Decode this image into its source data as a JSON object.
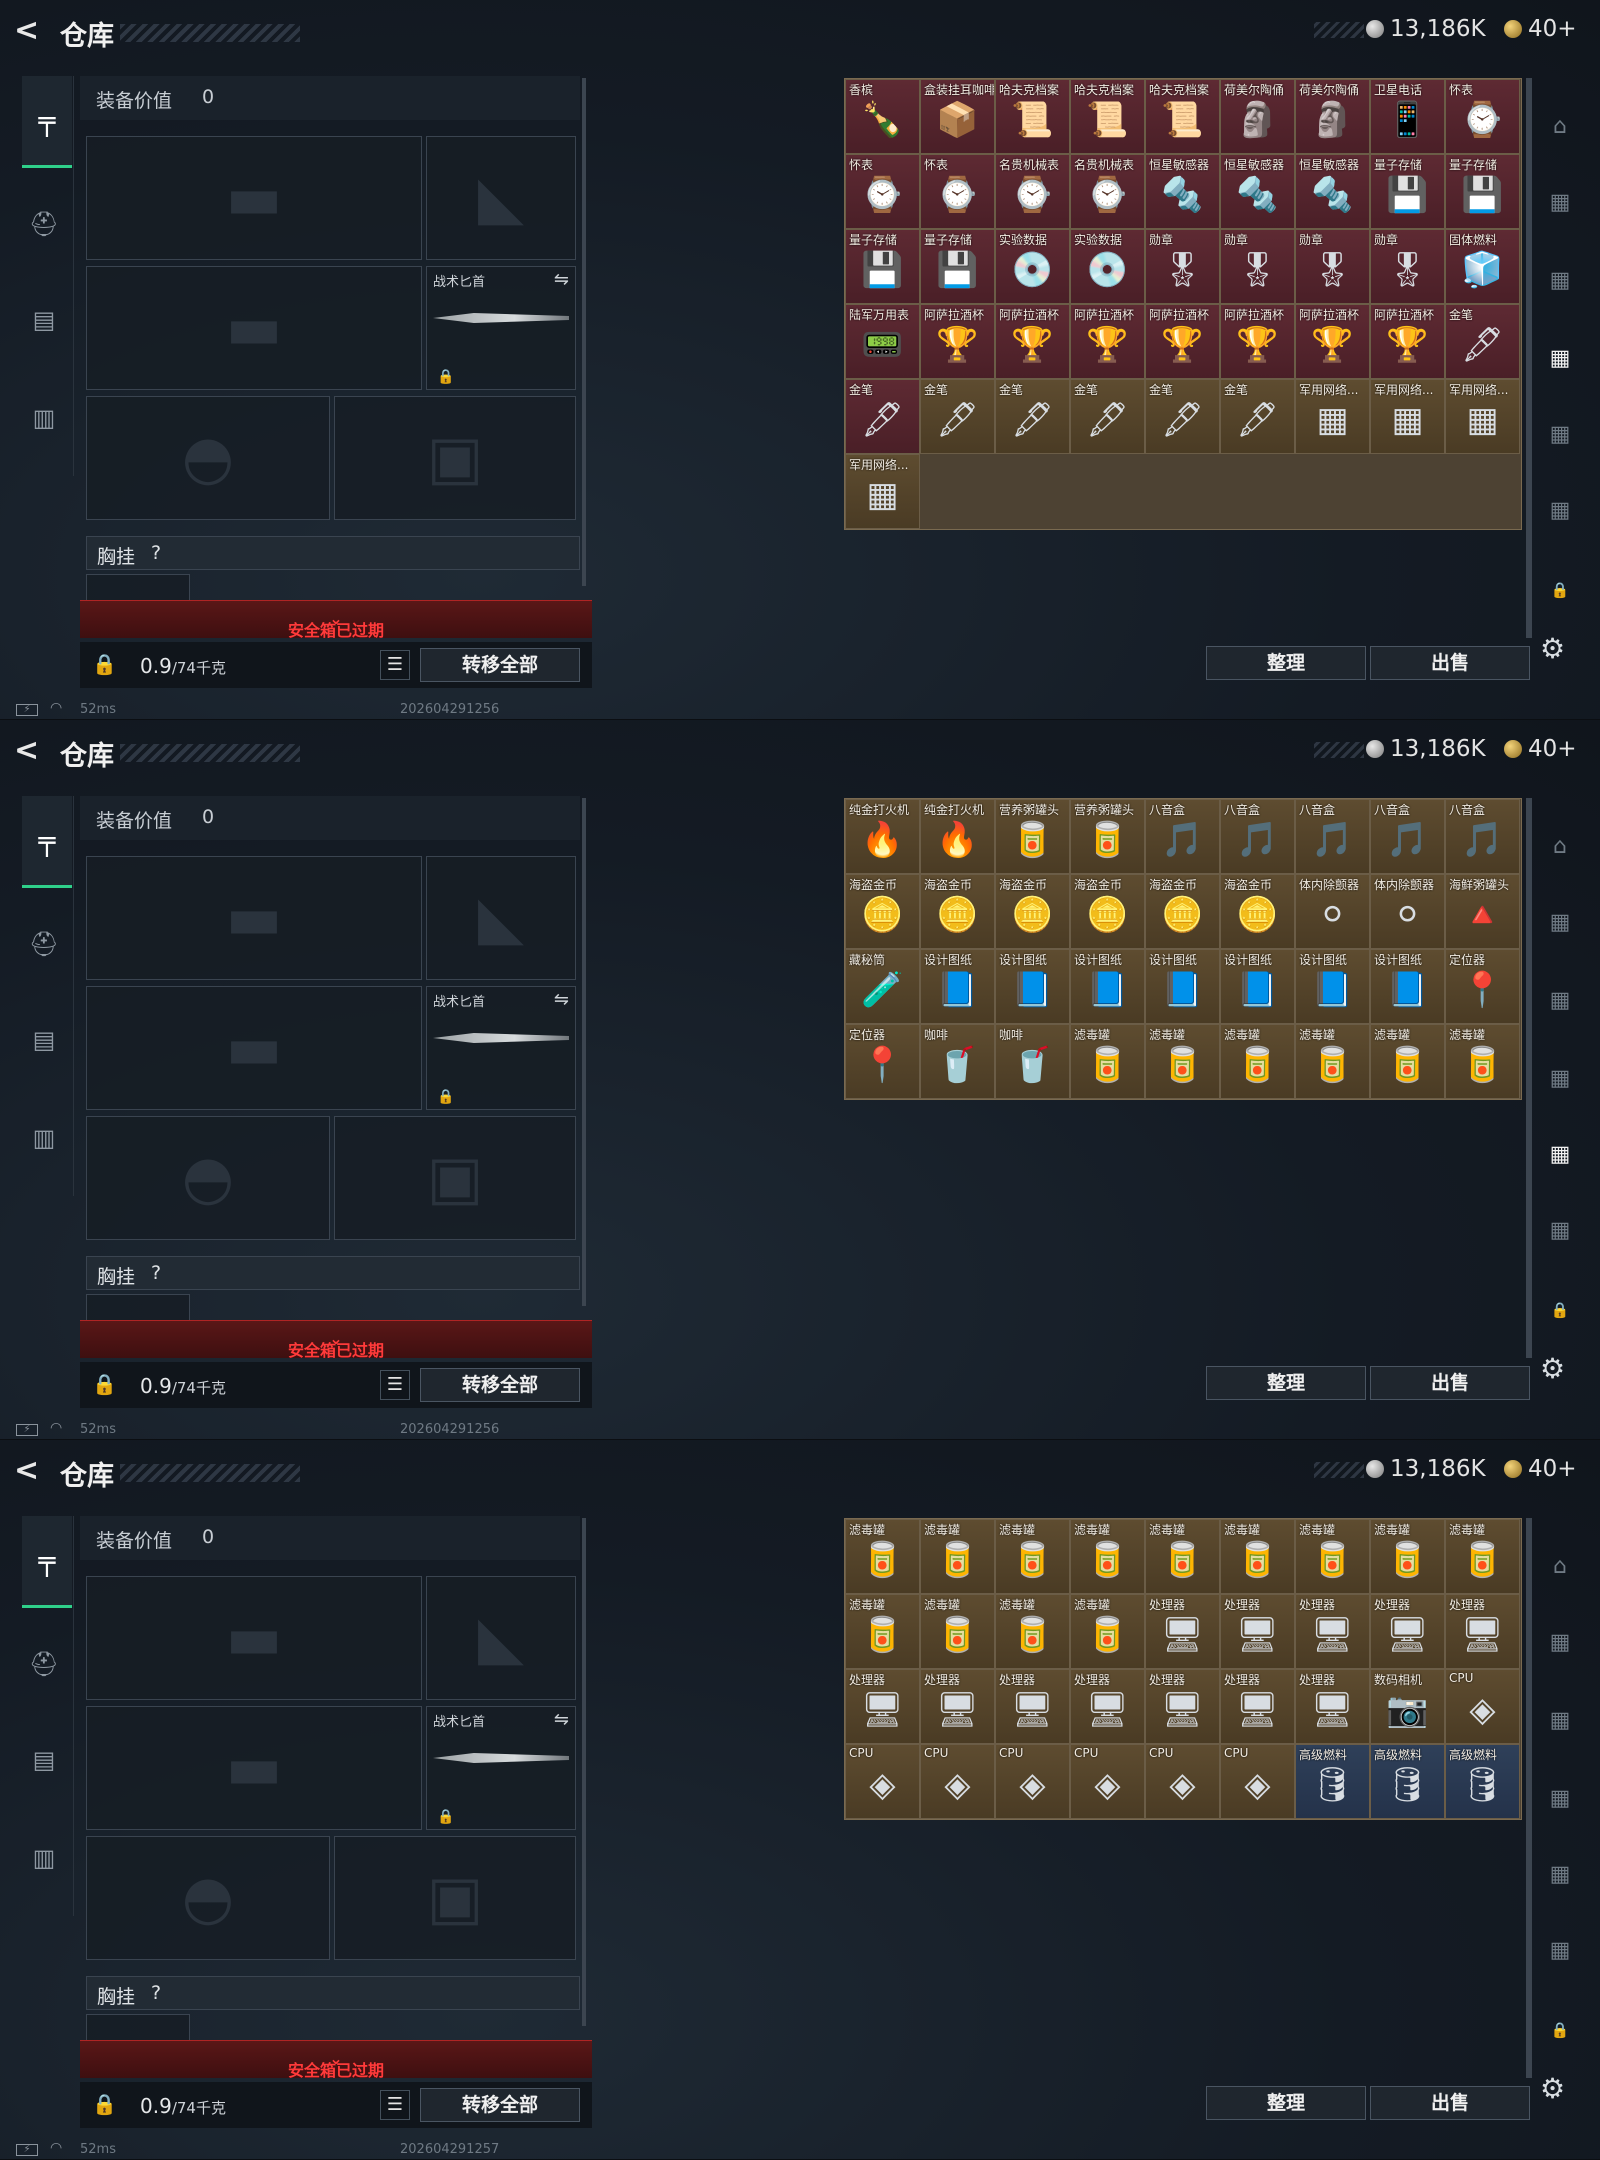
{
  "header": {
    "title": "仓库",
    "silver": "13,186K",
    "gold": "40+"
  },
  "equipment": {
    "value_label": "装备价值",
    "value": "0",
    "knife_label": "战术匕首",
    "vest_label": "胸挂",
    "vest_help": "?",
    "expired_text": "安全箱已过期",
    "weight_value": "0.9",
    "weight_unit": "/74千克",
    "transfer_label": "转移全部"
  },
  "actions": {
    "sort_label": "整理",
    "sell_label": "出售"
  },
  "colors": {
    "accent_green": "#2fd08a",
    "expired_red": "#ff3a3a"
  },
  "panels": [
    {
      "timestamp": "202604291256",
      "ping": "52ms",
      "items": [
        {
          "name": "香槟",
          "icon": "🍾",
          "rarity": "red",
          "span": 2
        },
        {
          "name": "盒装挂耳咖啡",
          "icon": "📦",
          "rarity": "red",
          "span": 2
        },
        {
          "name": "哈夫克档案",
          "icon": "📜",
          "rarity": "red",
          "span": 2
        },
        {
          "name": "哈夫克档案",
          "icon": "📜",
          "rarity": "red",
          "span": 2
        },
        {
          "name": "哈夫克档案",
          "icon": "📜",
          "rarity": "red",
          "span": 1
        },
        {
          "name": "荷美尔陶俑",
          "icon": "🗿",
          "rarity": "red",
          "span": 2
        },
        {
          "name": "荷美尔陶俑",
          "icon": "🗿",
          "rarity": "red",
          "span": 2
        },
        {
          "name": "卫星电话",
          "icon": "📱",
          "rarity": "red",
          "span": 2
        },
        {
          "name": "怀表",
          "icon": "⌚",
          "rarity": "red",
          "span": 1
        },
        {
          "name": "怀表",
          "icon": "⌚",
          "rarity": "red",
          "span": 1
        },
        {
          "name": "怀表",
          "icon": "⌚",
          "rarity": "red",
          "span": 1
        },
        {
          "name": "名贵机械表",
          "icon": "⌚",
          "rarity": "red",
          "span": 1
        },
        {
          "name": "名贵机械表",
          "icon": "⌚",
          "rarity": "red",
          "span": 1
        },
        {
          "name": "恒星敏感器",
          "icon": "🔩",
          "rarity": "red",
          "span": 1
        },
        {
          "name": "恒星敏感器",
          "icon": "🔩",
          "rarity": "red",
          "span": 1
        },
        {
          "name": "恒星敏感器",
          "icon": "🔩",
          "rarity": "red",
          "span": 1
        },
        {
          "name": "量子存储",
          "icon": "💾",
          "rarity": "red",
          "span": 1
        },
        {
          "name": "量子存储",
          "icon": "💾",
          "rarity": "red",
          "span": 1
        },
        {
          "name": "量子存储",
          "icon": "💾",
          "rarity": "red",
          "span": 1
        },
        {
          "name": "量子存储",
          "icon": "💾",
          "rarity": "red",
          "span": 1
        },
        {
          "name": "实验数据",
          "icon": "💿",
          "rarity": "red",
          "span": 1
        },
        {
          "name": "实验数据",
          "icon": "💿",
          "rarity": "red",
          "span": 1
        },
        {
          "name": "勋章",
          "icon": "🎖",
          "rarity": "red",
          "span": 1
        },
        {
          "name": "勋章",
          "icon": "🎖",
          "rarity": "red",
          "span": 1
        },
        {
          "name": "勋章",
          "icon": "🎖",
          "rarity": "red",
          "span": 1
        },
        {
          "name": "勋章",
          "icon": "🎖",
          "rarity": "red",
          "span": 1
        },
        {
          "name": "固体燃料",
          "icon": "🧊",
          "rarity": "red",
          "span": 1
        },
        {
          "name": "陆军万用表",
          "icon": "📟",
          "rarity": "red",
          "span": 1
        },
        {
          "name": "阿萨拉酒杯",
          "icon": "🏆",
          "rarity": "red",
          "span": 1
        },
        {
          "name": "阿萨拉酒杯",
          "icon": "🏆",
          "rarity": "red",
          "span": 1
        },
        {
          "name": "阿萨拉酒杯",
          "icon": "🏆",
          "rarity": "red",
          "span": 1
        },
        {
          "name": "阿萨拉酒杯",
          "icon": "🏆",
          "rarity": "red",
          "span": 1
        },
        {
          "name": "阿萨拉酒杯",
          "icon": "🏆",
          "rarity": "red",
          "span": 1
        },
        {
          "name": "阿萨拉酒杯",
          "icon": "🏆",
          "rarity": "red",
          "span": 1
        },
        {
          "name": "阿萨拉酒杯",
          "icon": "🏆",
          "rarity": "red",
          "span": 1
        },
        {
          "name": "金笔",
          "icon": "🖋",
          "rarity": "red",
          "span": 1
        },
        {
          "name": "金笔",
          "icon": "🖋",
          "rarity": "red",
          "span": 1
        },
        {
          "name": "金笔",
          "icon": "🖋",
          "rarity": "gold",
          "span": 1
        },
        {
          "name": "金笔",
          "icon": "🖋",
          "rarity": "gold",
          "span": 1
        },
        {
          "name": "金笔",
          "icon": "🖋",
          "rarity": "gold",
          "span": 1
        },
        {
          "name": "金笔",
          "icon": "🖋",
          "rarity": "gold",
          "span": 1
        },
        {
          "name": "金笔",
          "icon": "🖋",
          "rarity": "gold",
          "span": 1
        },
        {
          "name": "军用网络...",
          "icon": "▦",
          "rarity": "gold",
          "span": 1
        },
        {
          "name": "军用网络...",
          "icon": "▦",
          "rarity": "gold",
          "span": 1
        },
        {
          "name": "军用网络...",
          "icon": "▦",
          "rarity": "gold",
          "span": 1
        },
        {
          "name": "军用网络...",
          "icon": "▦",
          "rarity": "gold",
          "span": 1
        }
      ]
    },
    {
      "timestamp": "202604291256",
      "ping": "52ms",
      "items": [
        {
          "name": "纯金打火机",
          "icon": "🔥",
          "rarity": "gold",
          "span": 1
        },
        {
          "name": "纯金打火机",
          "icon": "🔥",
          "rarity": "gold",
          "span": 1
        },
        {
          "name": "营养粥罐头",
          "icon": "🥫",
          "rarity": "gold",
          "span": 1
        },
        {
          "name": "营养粥罐头",
          "icon": "🥫",
          "rarity": "gold",
          "span": 1
        },
        {
          "name": "八音盒",
          "icon": "🎵",
          "rarity": "gold",
          "span": 1
        },
        {
          "name": "八音盒",
          "icon": "🎵",
          "rarity": "gold",
          "span": 1
        },
        {
          "name": "八音盒",
          "icon": "🎵",
          "rarity": "gold",
          "span": 1
        },
        {
          "name": "八音盒",
          "icon": "🎵",
          "rarity": "gold",
          "span": 1
        },
        {
          "name": "八音盒",
          "icon": "🎵",
          "rarity": "gold",
          "span": 1
        },
        {
          "name": "海盗金币",
          "icon": "🪙",
          "rarity": "gold",
          "span": 1
        },
        {
          "name": "海盗金币",
          "icon": "🪙",
          "rarity": "gold",
          "span": 1
        },
        {
          "name": "海盗金币",
          "icon": "🪙",
          "rarity": "gold",
          "span": 1
        },
        {
          "name": "海盗金币",
          "icon": "🪙",
          "rarity": "gold",
          "span": 1
        },
        {
          "name": "海盗金币",
          "icon": "🪙",
          "rarity": "gold",
          "span": 1
        },
        {
          "name": "海盗金币",
          "icon": "🪙",
          "rarity": "gold",
          "span": 1
        },
        {
          "name": "体内除颤器",
          "icon": "⚪",
          "rarity": "gold",
          "span": 1
        },
        {
          "name": "体内除颤器",
          "icon": "⚪",
          "rarity": "gold",
          "span": 1
        },
        {
          "name": "海鲜粥罐头",
          "icon": "🔺",
          "rarity": "gold",
          "span": 1
        },
        {
          "name": "藏秘筒",
          "icon": "🧪",
          "rarity": "gold",
          "span": 1
        },
        {
          "name": "设计图纸",
          "icon": "📘",
          "rarity": "gold",
          "span": 1
        },
        {
          "name": "设计图纸",
          "icon": "📘",
          "rarity": "gold",
          "span": 1
        },
        {
          "name": "设计图纸",
          "icon": "📘",
          "rarity": "gold",
          "span": 1
        },
        {
          "name": "设计图纸",
          "icon": "📘",
          "rarity": "gold",
          "span": 1
        },
        {
          "name": "设计图纸",
          "icon": "📘",
          "rarity": "gold",
          "span": 1
        },
        {
          "name": "设计图纸",
          "icon": "📘",
          "rarity": "gold",
          "span": 1
        },
        {
          "name": "设计图纸",
          "icon": "📘",
          "rarity": "gold",
          "span": 1
        },
        {
          "name": "定位器",
          "icon": "📍",
          "rarity": "gold",
          "span": 1
        },
        {
          "name": "定位器",
          "icon": "📍",
          "rarity": "gold",
          "span": 1
        },
        {
          "name": "咖啡",
          "icon": "🥤",
          "rarity": "gold",
          "span": 1
        },
        {
          "name": "咖啡",
          "icon": "🥤",
          "rarity": "gold",
          "span": 1
        },
        {
          "name": "滤毒罐",
          "icon": "🥫",
          "rarity": "gold",
          "span": 1
        },
        {
          "name": "滤毒罐",
          "icon": "🥫",
          "rarity": "gold",
          "span": 1
        },
        {
          "name": "滤毒罐",
          "icon": "🥫",
          "rarity": "gold",
          "span": 1
        },
        {
          "name": "滤毒罐",
          "icon": "🥫",
          "rarity": "gold",
          "span": 1
        },
        {
          "name": "滤毒罐",
          "icon": "🥫",
          "rarity": "gold",
          "span": 1
        },
        {
          "name": "滤毒罐",
          "icon": "🥫",
          "rarity": "gold",
          "span": 1
        }
      ]
    },
    {
      "timestamp": "202604291257",
      "ping": "52ms",
      "items": [
        {
          "name": "滤毒罐",
          "icon": "🥫",
          "rarity": "gold",
          "span": 1
        },
        {
          "name": "滤毒罐",
          "icon": "🥫",
          "rarity": "gold",
          "span": 1
        },
        {
          "name": "滤毒罐",
          "icon": "🥫",
          "rarity": "gold",
          "span": 1
        },
        {
          "name": "滤毒罐",
          "icon": "🥫",
          "rarity": "gold",
          "span": 1
        },
        {
          "name": "滤毒罐",
          "icon": "🥫",
          "rarity": "gold",
          "span": 1
        },
        {
          "name": "滤毒罐",
          "icon": "🥫",
          "rarity": "gold",
          "span": 1
        },
        {
          "name": "滤毒罐",
          "icon": "🥫",
          "rarity": "gold",
          "span": 1
        },
        {
          "name": "滤毒罐",
          "icon": "🥫",
          "rarity": "gold",
          "span": 1
        },
        {
          "name": "滤毒罐",
          "icon": "🥫",
          "rarity": "gold",
          "span": 1
        },
        {
          "name": "滤毒罐",
          "icon": "🥫",
          "rarity": "gold",
          "span": 1
        },
        {
          "name": "滤毒罐",
          "icon": "🥫",
          "rarity": "gold",
          "span": 1
        },
        {
          "name": "滤毒罐",
          "icon": "🥫",
          "rarity": "gold",
          "span": 1
        },
        {
          "name": "滤毒罐",
          "icon": "🥫",
          "rarity": "gold",
          "span": 1
        },
        {
          "name": "处理器",
          "icon": "🖥",
          "rarity": "gold",
          "span": 1
        },
        {
          "name": "处理器",
          "icon": "🖥",
          "rarity": "gold",
          "span": 1
        },
        {
          "name": "处理器",
          "icon": "🖥",
          "rarity": "gold",
          "span": 1
        },
        {
          "name": "处理器",
          "icon": "🖥",
          "rarity": "gold",
          "span": 1
        },
        {
          "name": "处理器",
          "icon": "🖥",
          "rarity": "gold",
          "span": 1
        },
        {
          "name": "处理器",
          "icon": "🖥",
          "rarity": "gold",
          "span": 1
        },
        {
          "name": "处理器",
          "icon": "🖥",
          "rarity": "gold",
          "span": 1
        },
        {
          "name": "处理器",
          "icon": "🖥",
          "rarity": "gold",
          "span": 1
        },
        {
          "name": "处理器",
          "icon": "🖥",
          "rarity": "gold",
          "span": 1
        },
        {
          "name": "处理器",
          "icon": "🖥",
          "rarity": "gold",
          "span": 1
        },
        {
          "name": "处理器",
          "icon": "🖥",
          "rarity": "gold",
          "span": 1
        },
        {
          "name": "处理器",
          "icon": "🖥",
          "rarity": "gold",
          "span": 1
        },
        {
          "name": "数码相机",
          "icon": "📷",
          "rarity": "gold",
          "span": 1
        },
        {
          "name": "CPU",
          "icon": "◈",
          "rarity": "gold",
          "span": 1
        },
        {
          "name": "CPU",
          "icon": "◈",
          "rarity": "gold",
          "span": 1
        },
        {
          "name": "CPU",
          "icon": "◈",
          "rarity": "gold",
          "span": 1
        },
        {
          "name": "CPU",
          "icon": "◈",
          "rarity": "gold",
          "span": 1
        },
        {
          "name": "CPU",
          "icon": "◈",
          "rarity": "gold",
          "span": 1
        },
        {
          "name": "CPU",
          "icon": "◈",
          "rarity": "gold",
          "span": 1
        },
        {
          "name": "CPU",
          "icon": "◈",
          "rarity": "gold",
          "span": 1
        },
        {
          "name": "高级燃料",
          "icon": "🛢",
          "rarity": "blue",
          "span": 1
        },
        {
          "name": "高级燃料",
          "icon": "🛢",
          "rarity": "blue",
          "span": 1
        },
        {
          "name": "高级燃料",
          "icon": "🛢",
          "rarity": "blue",
          "span": 1
        }
      ]
    }
  ]
}
